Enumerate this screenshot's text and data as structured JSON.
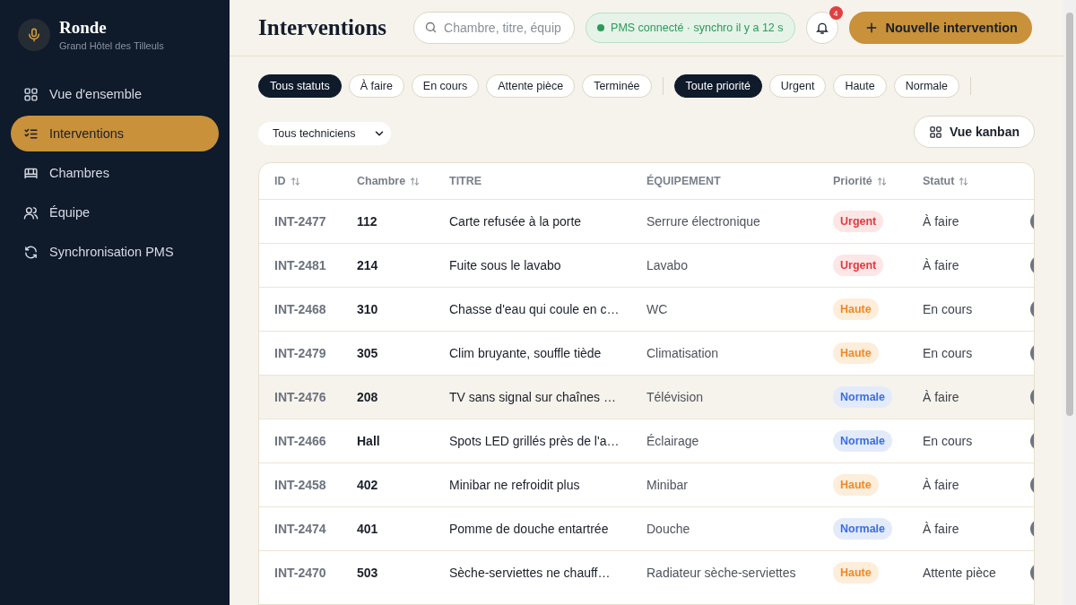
{
  "sidebar": {
    "brand": {
      "name": "Ronde",
      "subtitle": "Grand Hôtel des Tilleuls"
    },
    "items": [
      {
        "label": "Vue d'ensemble",
        "selected": false
      },
      {
        "label": "Interventions",
        "selected": true
      },
      {
        "label": "Chambres",
        "selected": false
      },
      {
        "label": "Équipe",
        "selected": false
      },
      {
        "label": "Synchronisation PMS",
        "selected": false
      }
    ]
  },
  "header": {
    "title": "Interventions",
    "search": {
      "placeholder": "Chambre, titre, équip"
    },
    "sync_status": "PMS connecté · synchro il y a 12 s",
    "notifications": "4",
    "new_button": "Nouvelle intervention"
  },
  "filters": {
    "status": [
      {
        "label": "Tous statuts",
        "selected": true
      },
      {
        "label": "À faire",
        "selected": false
      },
      {
        "label": "En cours",
        "selected": false
      },
      {
        "label": "Attente pièce",
        "selected": false
      },
      {
        "label": "Terminée",
        "selected": false
      }
    ],
    "priority": [
      {
        "label": "Toute priorité",
        "selected": true
      },
      {
        "label": "Urgent",
        "selected": false
      },
      {
        "label": "Haute",
        "selected": false
      },
      {
        "label": "Normale",
        "selected": false
      }
    ],
    "technician": "Tous techniciens",
    "view_button": "Vue kanban"
  },
  "table": {
    "columns": [
      {
        "label": "ID",
        "sortable": true
      },
      {
        "label": "Chambre",
        "sortable": true
      },
      {
        "label": "TITRE",
        "sortable": false
      },
      {
        "label": "ÉQUIPEMENT",
        "sortable": false
      },
      {
        "label": "Priorité",
        "sortable": true
      },
      {
        "label": "Statut",
        "sortable": true
      }
    ],
    "rows": [
      {
        "id": "INT-2477",
        "room": "112",
        "title": "Carte refusée à la porte",
        "equipment": "Serrure électronique",
        "priority": {
          "label": "Urgent",
          "kind": "urgent"
        },
        "status": "À faire",
        "selected": false
      },
      {
        "id": "INT-2481",
        "room": "214",
        "title": "Fuite sous le lavabo",
        "equipment": "Lavabo",
        "priority": {
          "label": "Urgent",
          "kind": "urgent"
        },
        "status": "À faire",
        "selected": false
      },
      {
        "id": "INT-2468",
        "room": "310",
        "title": "Chasse d'eau qui coule en c…",
        "equipment": "WC",
        "priority": {
          "label": "Haute",
          "kind": "high"
        },
        "status": "En cours",
        "selected": false
      },
      {
        "id": "INT-2479",
        "room": "305",
        "title": "Clim bruyante, souffle tiède",
        "equipment": "Climatisation",
        "priority": {
          "label": "Haute",
          "kind": "high"
        },
        "status": "En cours",
        "selected": false
      },
      {
        "id": "INT-2476",
        "room": "208",
        "title": "TV sans signal sur chaînes …",
        "equipment": "Télévision",
        "priority": {
          "label": "Normale",
          "kind": "normal"
        },
        "status": "À faire",
        "selected": true
      },
      {
        "id": "INT-2466",
        "room": "Hall",
        "title": "Spots LED grillés près de l'a…",
        "equipment": "Éclairage",
        "priority": {
          "label": "Normale",
          "kind": "normal"
        },
        "status": "En cours",
        "selected": false
      },
      {
        "id": "INT-2458",
        "room": "402",
        "title": "Minibar ne refroidit plus",
        "equipment": "Minibar",
        "priority": {
          "label": "Haute",
          "kind": "high"
        },
        "status": "À faire",
        "selected": false
      },
      {
        "id": "INT-2474",
        "room": "401",
        "title": "Pomme de douche entartrée",
        "equipment": "Douche",
        "priority": {
          "label": "Normale",
          "kind": "normal"
        },
        "status": "À faire",
        "selected": false
      },
      {
        "id": "INT-2470",
        "room": "503",
        "title": "Sèche-serviettes ne chauff…",
        "equipment": "Radiateur sèche-serviettes",
        "priority": {
          "label": "Haute",
          "kind": "high"
        },
        "status": "Attente pièce",
        "selected": false
      }
    ]
  }
}
